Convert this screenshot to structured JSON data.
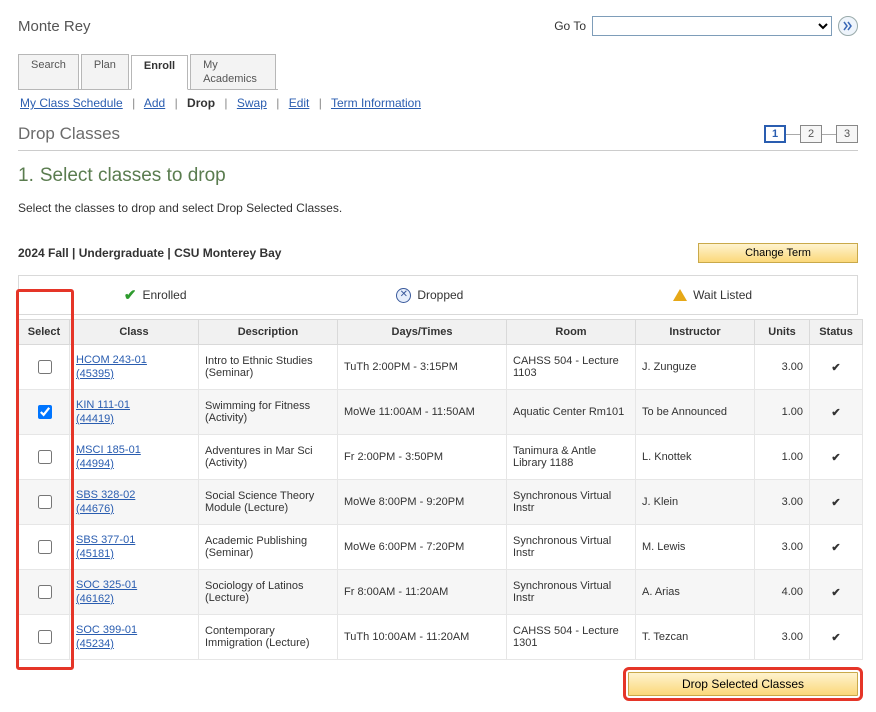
{
  "user_name": "Monte Rey",
  "goto_label": "Go To",
  "tabs": {
    "search": "Search",
    "plan": "Plan",
    "enroll": "Enroll",
    "academics": "My Academics"
  },
  "subnav": {
    "schedule": "My Class Schedule",
    "add": "Add",
    "drop": "Drop",
    "swap": "Swap",
    "edit": "Edit",
    "term": "Term Information"
  },
  "page_heading": "Drop Classes",
  "steps": [
    "1",
    "2",
    "3"
  ],
  "step_title_num": "1.",
  "step_title_text": "Select classes to drop",
  "instructions": "Select the classes to drop and select Drop Selected Classes.",
  "term_label": "2024 Fall | Undergraduate | CSU Monterey Bay",
  "change_term": "Change Term",
  "legend": {
    "enrolled": "Enrolled",
    "dropped": "Dropped",
    "wait": "Wait Listed"
  },
  "columns": {
    "select": "Select",
    "class": "Class",
    "desc": "Description",
    "days": "Days/Times",
    "room": "Room",
    "instr": "Instructor",
    "units": "Units",
    "status": "Status"
  },
  "rows": [
    {
      "checked": false,
      "class_code": "HCOM 243-01",
      "class_nbr": "(45395)",
      "desc": "Intro to Ethnic Studies (Seminar)",
      "days": "TuTh 2:00PM - 3:15PM",
      "room": "CAHSS 504 - Lecture 1103",
      "instr": "J. Zunguze",
      "units": "3.00"
    },
    {
      "checked": true,
      "class_code": "KIN 111-01",
      "class_nbr": "(44419)",
      "desc": "Swimming for Fitness (Activity)",
      "days": "MoWe 11:00AM - 11:50AM",
      "room": "Aquatic Center Rm101",
      "instr": "To be Announced",
      "units": "1.00"
    },
    {
      "checked": false,
      "class_code": "MSCI 185-01",
      "class_nbr": "(44994)",
      "desc": "Adventures in Mar Sci (Activity)",
      "days": "Fr 2:00PM - 3:50PM",
      "room": "Tanimura & Antle Library 1188",
      "instr": "L. Knottek",
      "units": "1.00"
    },
    {
      "checked": false,
      "class_code": "SBS 328-02",
      "class_nbr": "(44676)",
      "desc": "Social Science Theory Module (Lecture)",
      "days": "MoWe 8:00PM - 9:20PM",
      "room": "Synchronous Virtual Instr",
      "instr": "J. Klein",
      "units": "3.00"
    },
    {
      "checked": false,
      "class_code": "SBS 377-01",
      "class_nbr": "(45181)",
      "desc": "Academic Publishing (Seminar)",
      "days": "MoWe 6:00PM - 7:20PM",
      "room": "Synchronous Virtual Instr",
      "instr": "M. Lewis",
      "units": "3.00"
    },
    {
      "checked": false,
      "class_code": "SOC 325-01",
      "class_nbr": "(46162)",
      "desc": "Sociology of Latinos (Lecture)",
      "days": "Fr 8:00AM - 11:20AM",
      "room": "Synchronous Virtual Instr",
      "instr": "A. Arias",
      "units": "4.00"
    },
    {
      "checked": false,
      "class_code": "SOC 399-01",
      "class_nbr": "(45234)",
      "desc": "Contemporary Immigration (Lecture)",
      "days": "TuTh 10:00AM - 11:20AM",
      "room": "CAHSS 504 - Lecture 1301",
      "instr": "T. Tezcan",
      "units": "3.00"
    }
  ],
  "drop_button": "Drop Selected Classes"
}
